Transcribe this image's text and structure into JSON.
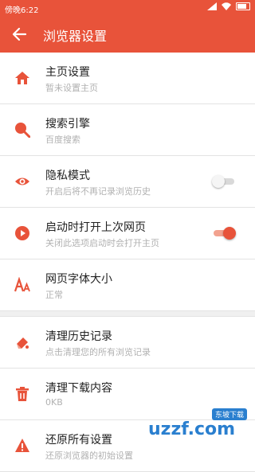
{
  "status": {
    "time": "傍晚6:22"
  },
  "toolbar": {
    "title": "浏览器设置"
  },
  "items": [
    {
      "title": "主页设置",
      "subtitle": "暂未设置主页",
      "icon": "home-icon"
    },
    {
      "title": "搜索引擎",
      "subtitle": "百度搜索",
      "icon": "search-icon"
    },
    {
      "title": "隐私模式",
      "subtitle": "开启后将不再记录浏览历史",
      "icon": "eye-icon",
      "toggle": false
    },
    {
      "title": "启动时打开上次网页",
      "subtitle": "关闭此选项启动时会打开主页",
      "icon": "play-icon",
      "toggle": true
    },
    {
      "title": "网页字体大小",
      "subtitle": "正常",
      "icon": "font-size-icon"
    },
    {
      "title": "清理历史记录",
      "subtitle": "点击清理您的所有浏览记录",
      "icon": "eraser-icon"
    },
    {
      "title": "清理下载内容",
      "subtitle": "0KB",
      "icon": "trash-icon"
    },
    {
      "title": "还原所有设置",
      "subtitle": "还原浏览器的初始设置",
      "icon": "warning-icon"
    }
  ],
  "watermark": {
    "text": "uzzf.com",
    "badge": "东坡下载"
  },
  "colors": {
    "accent": "#e8533a"
  }
}
